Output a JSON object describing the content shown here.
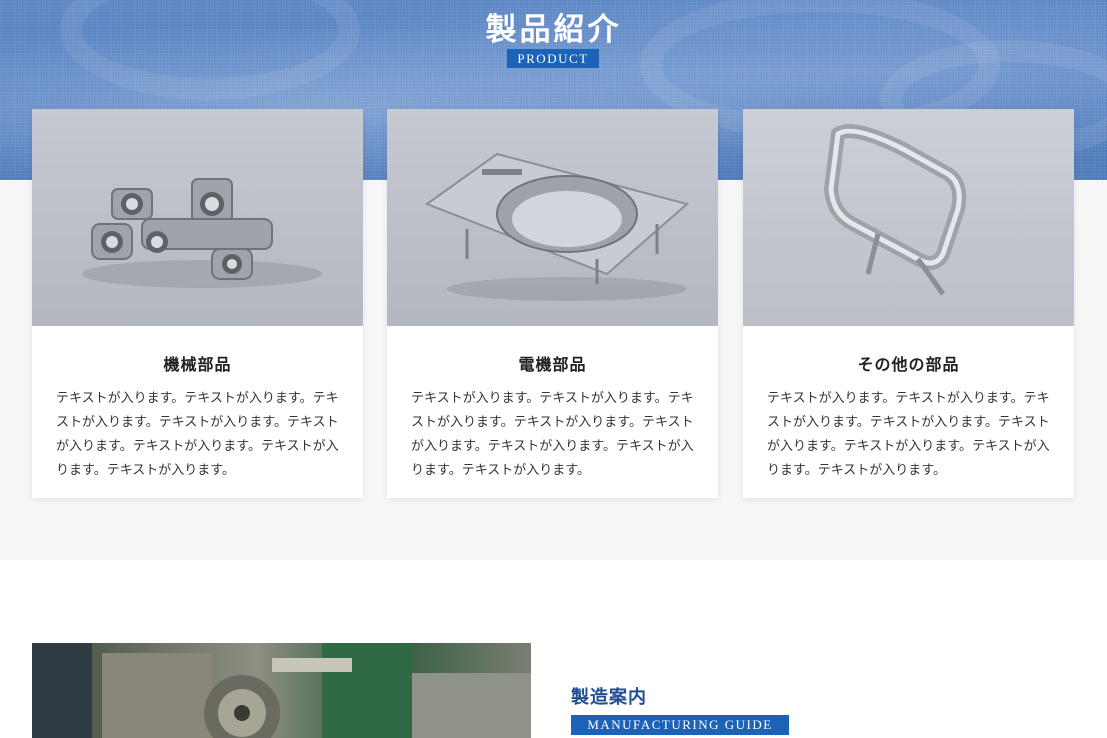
{
  "product": {
    "title": "製品紹介",
    "subtitle": "PRODUCT",
    "cards": [
      {
        "title": "機械部品",
        "text": "テキストが入ります。テキストが入ります。テキストが入ります。テキストが入ります。テキストが入ります。テキストが入ります。テキストが入ります。テキストが入ります。",
        "image_icon": "mechanical-part-image"
      },
      {
        "title": "電機部品",
        "text": "テキストが入ります。テキストが入ります。テキストが入ります。テキストが入ります。テキストが入ります。テキストが入ります。テキストが入ります。テキストが入ります。",
        "image_icon": "electrical-part-image"
      },
      {
        "title": "その他の部品",
        "text": "テキストが入ります。テキストが入ります。テキストが入ります。テキストが入ります。テキストが入ります。テキストが入ります。テキストが入ります。テキストが入ります。",
        "image_icon": "other-part-image"
      }
    ]
  },
  "manufacturing": {
    "title": "製造案内",
    "subtitle": "MANUFACTURING GUIDE",
    "image_icon": "lathe-machine-image"
  },
  "colors": {
    "hero_blue": "#5c86c4",
    "label_blue": "#1a63b8",
    "heading_navy": "#1f4f8f"
  }
}
